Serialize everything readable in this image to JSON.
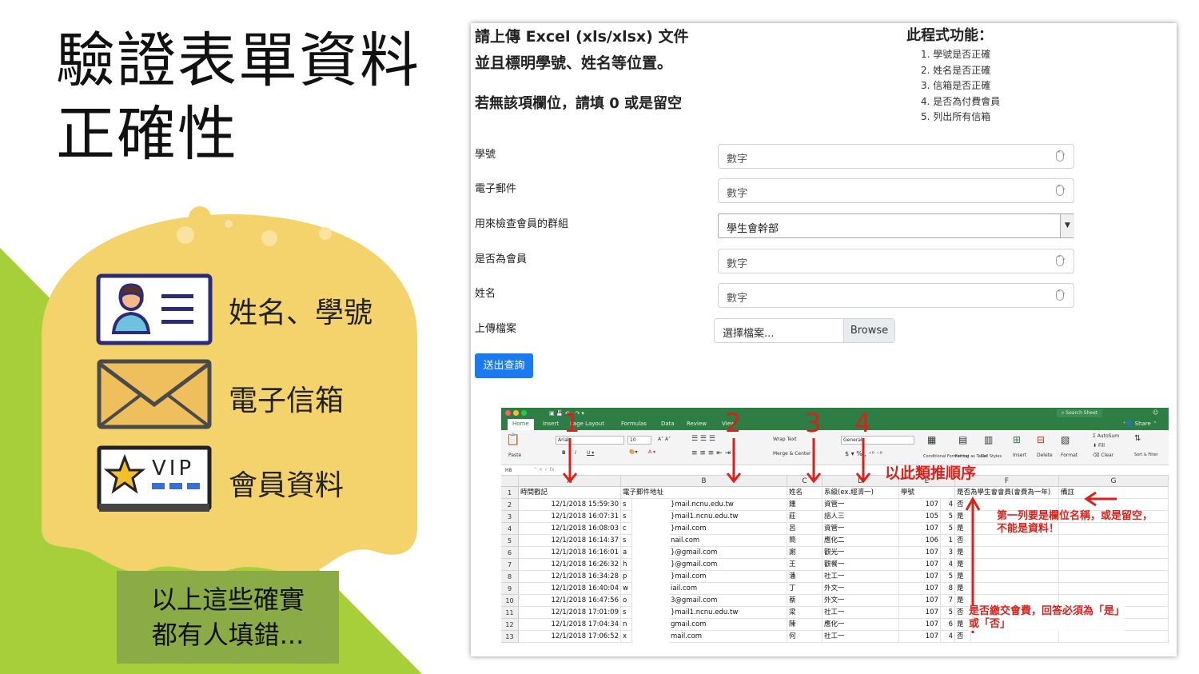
{
  "slide": {
    "title_line1": "驗證表單資料",
    "title_line2": "正確性",
    "features": [
      {
        "icon": "id-card-icon",
        "label": "姓名、學號"
      },
      {
        "icon": "envelope-icon",
        "label": "電子信箱"
      },
      {
        "icon": "vip-card-icon",
        "label": "會員資料"
      }
    ],
    "note_line1": "以上這些確實",
    "note_line2": "都有人填錯...",
    "colors": {
      "green": "#a6cf3a",
      "yellow": "#f4d36c",
      "note_bg": "#8bab47"
    }
  },
  "form_page": {
    "heading1": "請上傳 Excel (xls/xlsx) 文件",
    "heading2": "並且標明學號、姓名等位置。",
    "heading3": "若無該項欄位，請填 0 或是留空",
    "functions_title": "此程式功能：",
    "functions": [
      "1. 學號是否正確",
      "2. 姓名是否正確",
      "3. 信箱是否正確",
      "4. 是否為付費會員",
      "5. 列出所有信箱"
    ],
    "fields": [
      {
        "label": "學號",
        "placeholder": "數字"
      },
      {
        "label": "電子郵件",
        "placeholder": "數字"
      },
      {
        "label": "用來檢查會員的群組",
        "value": "學生會幹部"
      },
      {
        "label": "是否為會員",
        "placeholder": "數字"
      },
      {
        "label": "姓名",
        "placeholder": "數字"
      }
    ],
    "upload_label": "上傳檔案",
    "file_placeholder": "選擇檔案...",
    "browse_label": "Browse",
    "submit_label": "送出查詢",
    "submit_color": "#1a7bf0"
  },
  "excel": {
    "tabs": [
      "Home",
      "Insert",
      "Page Layout",
      "Formulas",
      "Data",
      "Review",
      "View"
    ],
    "share": "Share",
    "search": "Search Sheet",
    "font_name": "Arial",
    "font_size": "10",
    "number_format": "General",
    "wrap_text": "Wrap Text",
    "merge_center": "Merge & Center",
    "paste": "Paste",
    "ribbon_buttons": [
      "Conditional Formatting",
      "Format as Table",
      "Cell Styles",
      "Insert",
      "Delete",
      "Format",
      "Sort & Filter"
    ],
    "autosum": "AutoSum",
    "fill": "Fill",
    "clear": "Clear",
    "name_box": "H8",
    "columns": [
      "A",
      "B",
      "C",
      "D",
      "E",
      "F",
      "G"
    ],
    "header_row": [
      "時間戳記",
      "電子郵件地址",
      "姓名",
      "系級(ex.經濟一)",
      "學號",
      "是否為學生會會員(會費為一年)",
      "備註"
    ],
    "rows": [
      [
        "12/1/2018 15:59:30",
        "s",
        "}mail.ncnu.edu.tw",
        "鍾",
        "資管一",
        "107",
        "4",
        "否"
      ],
      [
        "12/1/2018 16:07:31",
        "s",
        "}mail1.ncnu.edu.tw",
        "莊",
        "諮人三",
        "105",
        "5",
        "是"
      ],
      [
        "12/1/2018 16:08:03",
        "c",
        "}mail.com",
        "呂",
        "資管一",
        "107",
        "5",
        "是"
      ],
      [
        "12/1/2018 16:14:37",
        "s",
        "nail.com",
        "簡",
        "應化二",
        "106",
        "1",
        "否"
      ],
      [
        "12/1/2018 16:16:01",
        "a",
        "}@gmail.com",
        "謝",
        "觀光一",
        "107",
        "3",
        "是"
      ],
      [
        "12/1/2018 16:26:32",
        "h",
        "}@gmail.com",
        "王",
        "觀餐一",
        "107",
        "4",
        "是"
      ],
      [
        "12/1/2018 16:34:28",
        "p",
        "}mail.com",
        "潘",
        "社工一",
        "107",
        "5",
        "是"
      ],
      [
        "12/1/2018 16:40:04",
        "w",
        "iail.com",
        "丁",
        "外文一",
        "107",
        "8",
        "是"
      ],
      [
        "12/1/2018 16:47:56",
        "o",
        "3@gmail.com",
        "蔡",
        "外文一",
        "107",
        "7",
        "是"
      ],
      [
        "12/1/2018 17:01:09",
        "s",
        "}mail1.ncnu.edu.tw",
        "梁",
        "社工一",
        "107",
        "5",
        "否"
      ],
      [
        "12/1/2018 17:04:34",
        "n",
        "gmail.com",
        "陳",
        "應化一",
        "107",
        "6",
        "是"
      ],
      [
        "12/1/2018 17:06:52",
        "x",
        "mail.com",
        "何",
        "社工一",
        "107",
        "4",
        "否"
      ]
    ],
    "annotations": {
      "n1": "1",
      "n2": "2",
      "n3": "3",
      "n4": "4",
      "order_note": "以此類推順序",
      "row1_note_line1": "第一列要是欄位名稱，或是留空，",
      "row1_note_line2": "不能是資料！",
      "paid_note_line1": "是否繳交會費，回答必須為「是」",
      "paid_note_line2": "或「否」",
      "red": "#d9211b"
    }
  }
}
